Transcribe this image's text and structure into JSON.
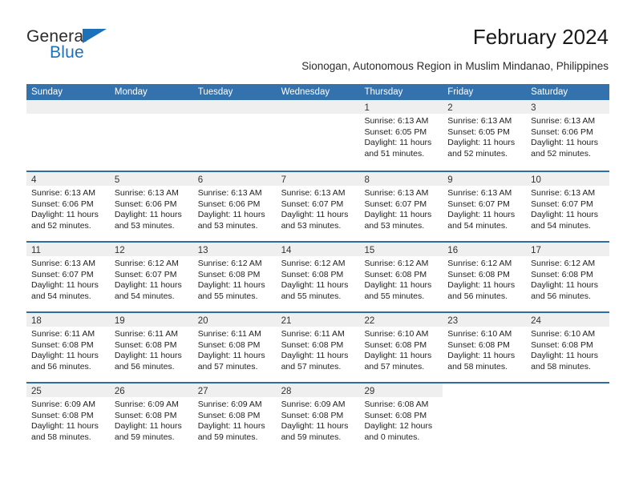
{
  "brand": {
    "name_top": "General",
    "name_bottom": "Blue",
    "accent_color": "#1b72b8"
  },
  "header": {
    "title": "February 2024",
    "subtitle": "Sionogan, Autonomous Region in Muslim Mindanao, Philippines"
  },
  "theme": {
    "header_blue": "#3372ad",
    "row_divider_blue": "#2e6da4",
    "daynum_band_gray": "#efefef"
  },
  "calendar": {
    "weekdays": [
      "Sunday",
      "Monday",
      "Tuesday",
      "Wednesday",
      "Thursday",
      "Friday",
      "Saturday"
    ],
    "weeks": [
      [
        {
          "day": "",
          "empty": true
        },
        {
          "day": "",
          "empty": true
        },
        {
          "day": "",
          "empty": true
        },
        {
          "day": "",
          "empty": true
        },
        {
          "day": "1",
          "sunrise": "Sunrise: 6:13 AM",
          "sunset": "Sunset: 6:05 PM",
          "daylight": "Daylight: 11 hours and 51 minutes."
        },
        {
          "day": "2",
          "sunrise": "Sunrise: 6:13 AM",
          "sunset": "Sunset: 6:05 PM",
          "daylight": "Daylight: 11 hours and 52 minutes."
        },
        {
          "day": "3",
          "sunrise": "Sunrise: 6:13 AM",
          "sunset": "Sunset: 6:06 PM",
          "daylight": "Daylight: 11 hours and 52 minutes."
        }
      ],
      [
        {
          "day": "4",
          "sunrise": "Sunrise: 6:13 AM",
          "sunset": "Sunset: 6:06 PM",
          "daylight": "Daylight: 11 hours and 52 minutes."
        },
        {
          "day": "5",
          "sunrise": "Sunrise: 6:13 AM",
          "sunset": "Sunset: 6:06 PM",
          "daylight": "Daylight: 11 hours and 53 minutes."
        },
        {
          "day": "6",
          "sunrise": "Sunrise: 6:13 AM",
          "sunset": "Sunset: 6:06 PM",
          "daylight": "Daylight: 11 hours and 53 minutes."
        },
        {
          "day": "7",
          "sunrise": "Sunrise: 6:13 AM",
          "sunset": "Sunset: 6:07 PM",
          "daylight": "Daylight: 11 hours and 53 minutes."
        },
        {
          "day": "8",
          "sunrise": "Sunrise: 6:13 AM",
          "sunset": "Sunset: 6:07 PM",
          "daylight": "Daylight: 11 hours and 53 minutes."
        },
        {
          "day": "9",
          "sunrise": "Sunrise: 6:13 AM",
          "sunset": "Sunset: 6:07 PM",
          "daylight": "Daylight: 11 hours and 54 minutes."
        },
        {
          "day": "10",
          "sunrise": "Sunrise: 6:13 AM",
          "sunset": "Sunset: 6:07 PM",
          "daylight": "Daylight: 11 hours and 54 minutes."
        }
      ],
      [
        {
          "day": "11",
          "sunrise": "Sunrise: 6:13 AM",
          "sunset": "Sunset: 6:07 PM",
          "daylight": "Daylight: 11 hours and 54 minutes."
        },
        {
          "day": "12",
          "sunrise": "Sunrise: 6:12 AM",
          "sunset": "Sunset: 6:07 PM",
          "daylight": "Daylight: 11 hours and 54 minutes."
        },
        {
          "day": "13",
          "sunrise": "Sunrise: 6:12 AM",
          "sunset": "Sunset: 6:08 PM",
          "daylight": "Daylight: 11 hours and 55 minutes."
        },
        {
          "day": "14",
          "sunrise": "Sunrise: 6:12 AM",
          "sunset": "Sunset: 6:08 PM",
          "daylight": "Daylight: 11 hours and 55 minutes."
        },
        {
          "day": "15",
          "sunrise": "Sunrise: 6:12 AM",
          "sunset": "Sunset: 6:08 PM",
          "daylight": "Daylight: 11 hours and 55 minutes."
        },
        {
          "day": "16",
          "sunrise": "Sunrise: 6:12 AM",
          "sunset": "Sunset: 6:08 PM",
          "daylight": "Daylight: 11 hours and 56 minutes."
        },
        {
          "day": "17",
          "sunrise": "Sunrise: 6:12 AM",
          "sunset": "Sunset: 6:08 PM",
          "daylight": "Daylight: 11 hours and 56 minutes."
        }
      ],
      [
        {
          "day": "18",
          "sunrise": "Sunrise: 6:11 AM",
          "sunset": "Sunset: 6:08 PM",
          "daylight": "Daylight: 11 hours and 56 minutes."
        },
        {
          "day": "19",
          "sunrise": "Sunrise: 6:11 AM",
          "sunset": "Sunset: 6:08 PM",
          "daylight": "Daylight: 11 hours and 56 minutes."
        },
        {
          "day": "20",
          "sunrise": "Sunrise: 6:11 AM",
          "sunset": "Sunset: 6:08 PM",
          "daylight": "Daylight: 11 hours and 57 minutes."
        },
        {
          "day": "21",
          "sunrise": "Sunrise: 6:11 AM",
          "sunset": "Sunset: 6:08 PM",
          "daylight": "Daylight: 11 hours and 57 minutes."
        },
        {
          "day": "22",
          "sunrise": "Sunrise: 6:10 AM",
          "sunset": "Sunset: 6:08 PM",
          "daylight": "Daylight: 11 hours and 57 minutes."
        },
        {
          "day": "23",
          "sunrise": "Sunrise: 6:10 AM",
          "sunset": "Sunset: 6:08 PM",
          "daylight": "Daylight: 11 hours and 58 minutes."
        },
        {
          "day": "24",
          "sunrise": "Sunrise: 6:10 AM",
          "sunset": "Sunset: 6:08 PM",
          "daylight": "Daylight: 11 hours and 58 minutes."
        }
      ],
      [
        {
          "day": "25",
          "sunrise": "Sunrise: 6:09 AM",
          "sunset": "Sunset: 6:08 PM",
          "daylight": "Daylight: 11 hours and 58 minutes."
        },
        {
          "day": "26",
          "sunrise": "Sunrise: 6:09 AM",
          "sunset": "Sunset: 6:08 PM",
          "daylight": "Daylight: 11 hours and 59 minutes."
        },
        {
          "day": "27",
          "sunrise": "Sunrise: 6:09 AM",
          "sunset": "Sunset: 6:08 PM",
          "daylight": "Daylight: 11 hours and 59 minutes."
        },
        {
          "day": "28",
          "sunrise": "Sunrise: 6:09 AM",
          "sunset": "Sunset: 6:08 PM",
          "daylight": "Daylight: 11 hours and 59 minutes."
        },
        {
          "day": "29",
          "sunrise": "Sunrise: 6:08 AM",
          "sunset": "Sunset: 6:08 PM",
          "daylight": "Daylight: 12 hours and 0 minutes."
        },
        {
          "day": "",
          "empty": true,
          "blank": true
        },
        {
          "day": "",
          "empty": true,
          "blank": true
        }
      ]
    ]
  }
}
